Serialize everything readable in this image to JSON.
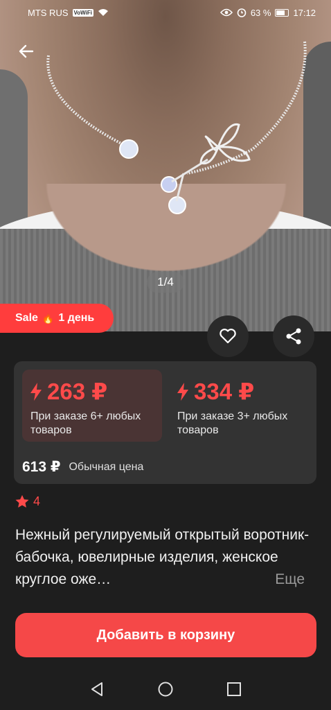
{
  "status_bar": {
    "carrier": "MTS RUS",
    "vowifi": "VoWiFi",
    "battery": "63 %",
    "battery_level": 0.63,
    "time": "17:12"
  },
  "gallery": {
    "counter": "1/4"
  },
  "sale_badge": {
    "label": "Sale",
    "flame": "🔥",
    "duration": "1 день"
  },
  "prices": {
    "tiers": [
      {
        "price": "263 ₽",
        "note": "При заказе 6+ любых товаров"
      },
      {
        "price": "334 ₽",
        "note": "При заказе 3+ любых товаров"
      }
    ],
    "regular_price": "613 ₽",
    "regular_label": "Обычная цена"
  },
  "rating": {
    "value": "4"
  },
  "product": {
    "title": "Нежный регулируемый открытый воротник-бабочка, ювелирные изделия, женское круглое оже…",
    "more": "Еще"
  },
  "actions": {
    "add_to_cart": "Добавить в корзину"
  },
  "colors": {
    "accent": "#f54848",
    "price_red": "#ff4a4a",
    "background": "#1e1e1e",
    "card": "#333333"
  },
  "icons": [
    "back-arrow-icon",
    "heart-icon",
    "share-icon",
    "flash-icon",
    "star-icon",
    "nav-back-icon",
    "nav-home-icon",
    "nav-recents-icon",
    "wifi-icon",
    "eye-icon",
    "alarm-icon",
    "battery-icon"
  ]
}
